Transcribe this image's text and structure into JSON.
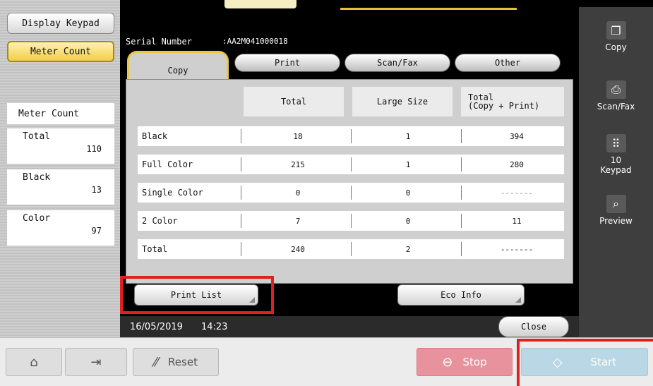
{
  "left_panel": {
    "display_keypad": "Display Keypad",
    "meter_count_btn": "Meter Count",
    "heading": "Meter Count",
    "counters": [
      {
        "label": "Total",
        "value": "110"
      },
      {
        "label": "Black",
        "value": "13"
      },
      {
        "label": "Color",
        "value": "97"
      }
    ]
  },
  "header": {
    "serial_label": "Serial Number",
    "serial_value": ":AA2M041000018"
  },
  "tabs": [
    "Copy",
    "Print",
    "Scan/Fax",
    "Other"
  ],
  "active_tab": "Copy",
  "table": {
    "columns": [
      "Total",
      "Large Size",
      "Total\n(Copy + Print)"
    ],
    "rows": [
      {
        "name": "Black",
        "total": "18",
        "large": "1",
        "combined": "394"
      },
      {
        "name": "Full Color",
        "total": "215",
        "large": "1",
        "combined": "280"
      },
      {
        "name": "Single Color",
        "total": "0",
        "large": "0",
        "combined": "-------"
      },
      {
        "name": "2 Color",
        "total": "7",
        "large": "0",
        "combined": "11"
      },
      {
        "name": "Total",
        "total": "240",
        "large": "2",
        "combined": "-------"
      }
    ]
  },
  "buttons": {
    "print_list": "Print List",
    "eco_info": "Eco Info",
    "close": "Close"
  },
  "status": {
    "date": "16/05/2019",
    "time": "14:23"
  },
  "right_bar": {
    "copy": "Copy",
    "scan_fax": "Scan/Fax",
    "keypad_num": "10",
    "keypad": "Keypad",
    "preview": "Preview"
  },
  "bottom": {
    "reset": "Reset",
    "stop": "Stop",
    "start": "Start"
  },
  "colors": {
    "accent": "#e8c93f",
    "stop": "#e8929d",
    "start": "#b9d7e4",
    "highlight": "#e02020"
  }
}
